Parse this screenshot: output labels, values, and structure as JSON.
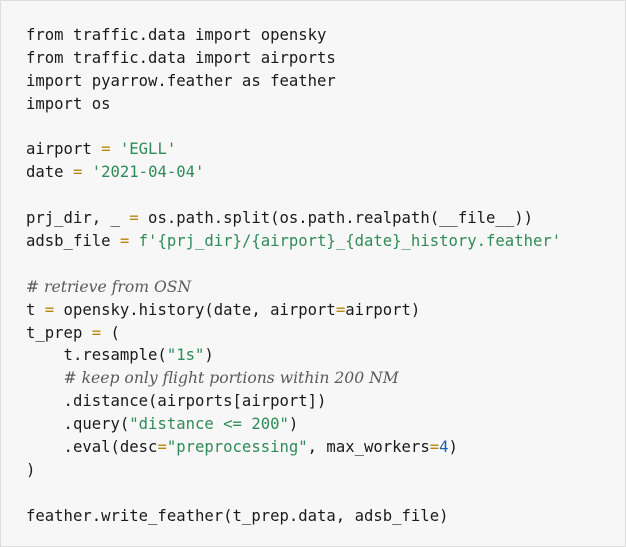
{
  "colors": {
    "background": "#f7f7f7",
    "text": "#1a1a1a",
    "operator": "#b8860b",
    "string": "#2e8b57",
    "number": "#1f60b0",
    "comment": "#5a5a5a"
  },
  "code": {
    "lines": [
      [
        {
          "t": "from traffic.data import opensky"
        }
      ],
      [
        {
          "t": "from traffic.data import airports"
        }
      ],
      [
        {
          "t": "import pyarrow.feather as feather"
        }
      ],
      [
        {
          "t": "import os"
        }
      ],
      [],
      [
        {
          "t": "airport "
        },
        {
          "t": "=",
          "c": "op"
        },
        {
          "t": " "
        },
        {
          "t": "'EGLL'",
          "c": "str"
        }
      ],
      [
        {
          "t": "date "
        },
        {
          "t": "=",
          "c": "op"
        },
        {
          "t": " "
        },
        {
          "t": "'2021-04-04'",
          "c": "str"
        }
      ],
      [],
      [
        {
          "t": "prj_dir, _ "
        },
        {
          "t": "=",
          "c": "op"
        },
        {
          "t": " os.path.split(os.path.realpath(__file__))"
        }
      ],
      [
        {
          "t": "adsb_file "
        },
        {
          "t": "=",
          "c": "op"
        },
        {
          "t": " f'{prj_dir}/{airport}_{date}_history.feather'",
          "c": "str"
        }
      ],
      [],
      [
        {
          "t": "# retrieve from OSN",
          "c": "comment"
        }
      ],
      [
        {
          "t": "t "
        },
        {
          "t": "=",
          "c": "op"
        },
        {
          "t": " opensky.history(date, airport"
        },
        {
          "t": "=",
          "c": "op"
        },
        {
          "t": "airport)"
        }
      ],
      [
        {
          "t": "t_prep "
        },
        {
          "t": "=",
          "c": "op"
        },
        {
          "t": " ("
        }
      ],
      [
        {
          "t": "    t.resample("
        },
        {
          "t": "\"1s\"",
          "c": "str"
        },
        {
          "t": ")"
        }
      ],
      [
        {
          "t": "    "
        },
        {
          "t": "# keep only flight portions within 200 NM",
          "c": "comment"
        }
      ],
      [
        {
          "t": "    .distance(airports[airport])"
        }
      ],
      [
        {
          "t": "    .query("
        },
        {
          "t": "\"distance <= 200\"",
          "c": "str"
        },
        {
          "t": ")"
        }
      ],
      [
        {
          "t": "    .eval(desc"
        },
        {
          "t": "=",
          "c": "op"
        },
        {
          "t": "\"preprocessing\"",
          "c": "str"
        },
        {
          "t": ", max_workers"
        },
        {
          "t": "=",
          "c": "op"
        },
        {
          "t": "4",
          "c": "num"
        },
        {
          "t": ")"
        }
      ],
      [
        {
          "t": ")"
        }
      ],
      [],
      [
        {
          "t": "feather.write_feather(t_prep.data, adsb_file)"
        }
      ]
    ]
  }
}
